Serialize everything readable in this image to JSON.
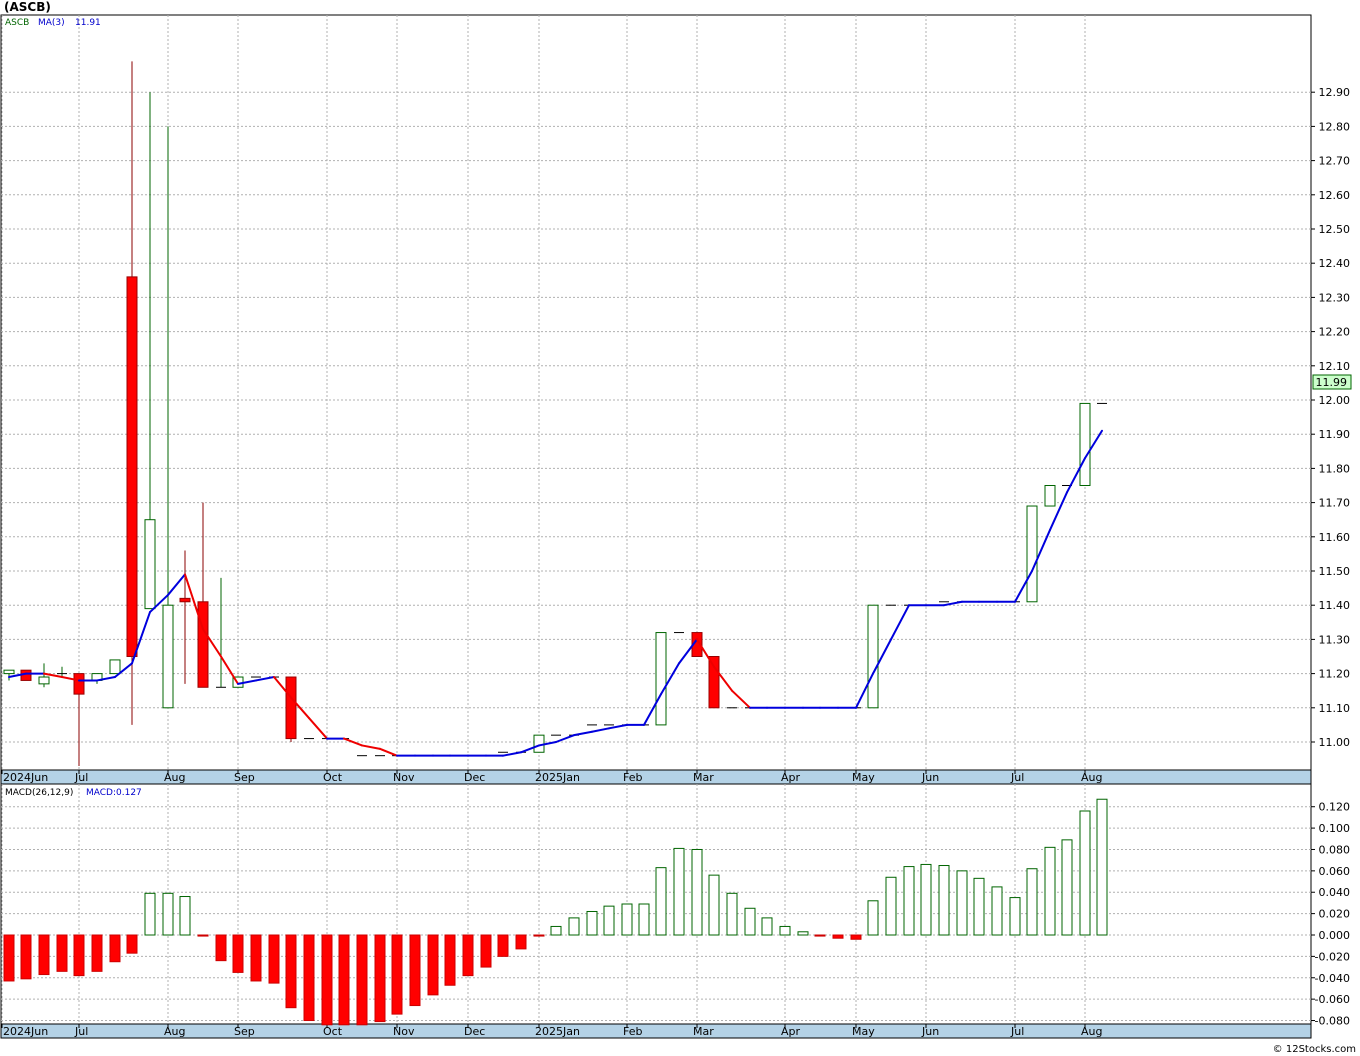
{
  "header": {
    "title": "(ASCB)",
    "credit": "© 12Stocks.com"
  },
  "legend": {
    "symbol": "ASCB",
    "ma_label": "MA(3)",
    "ma_value": "11.91",
    "macd_label": "MACD(26,12,9)",
    "macd_value": "MACD:0.127"
  },
  "last_price": "11.99",
  "colors": {
    "up": "#006400",
    "down": "#ff0000",
    "ma_up": "#0000dd",
    "ma_down": "#ee0000",
    "macd_up": "#006400",
    "macd_down": "#ff0000",
    "axis_band": "#b4d2e6",
    "grid": "#b0b0b0",
    "price_box": "#ccffcc"
  },
  "chart_data": [
    {
      "type": "candlestick",
      "series": [
        {
          "name": "ASCB"
        },
        {
          "name": "MA(3)"
        }
      ],
      "ylim": [
        10.93,
        13.0
      ],
      "y_ticks": [
        "11.00",
        "11.10",
        "11.20",
        "11.30",
        "11.40",
        "11.50",
        "11.60",
        "11.70",
        "11.80",
        "11.90",
        "12.00",
        "12.10",
        "12.20",
        "12.30",
        "12.40",
        "12.50",
        "12.60",
        "12.70",
        "12.80",
        "12.90"
      ],
      "x_ticks": [
        "2024Jun",
        "Jul",
        "Aug",
        "Sep",
        "Oct",
        "Nov",
        "Dec",
        "2025Jan",
        "Feb",
        "Mar",
        "Apr",
        "May",
        "Jun",
        "Jul",
        "Aug"
      ],
      "grid": true,
      "bars": [
        {
          "x": 9,
          "o": 11.2,
          "h": 11.21,
          "l": 11.18,
          "c": 11.21,
          "ma": 11.19
        },
        {
          "x": 26,
          "o": 11.21,
          "h": 11.21,
          "l": 11.18,
          "c": 11.18,
          "ma": 11.2
        },
        {
          "x": 44,
          "o": 11.17,
          "h": 11.23,
          "l": 11.16,
          "c": 11.19,
          "ma": 11.2
        },
        {
          "x": 62,
          "o": 11.2,
          "h": 11.22,
          "l": 11.19,
          "c": 11.2,
          "ma": 11.19
        },
        {
          "x": 79,
          "o": 11.2,
          "h": 11.2,
          "l": 10.93,
          "c": 11.14,
          "ma": 11.18
        },
        {
          "x": 97,
          "o": 11.18,
          "h": 11.2,
          "l": 11.17,
          "c": 11.2,
          "ma": 11.18
        },
        {
          "x": 115,
          "o": 11.2,
          "h": 11.24,
          "l": 11.2,
          "c": 11.24,
          "ma": 11.19
        },
        {
          "x": 132,
          "o": 12.36,
          "h": 12.99,
          "l": 11.05,
          "c": 11.25,
          "ma": 11.23
        },
        {
          "x": 150,
          "o": 11.39,
          "h": 12.9,
          "l": 11.39,
          "c": 11.65,
          "ma": 11.38
        },
        {
          "x": 168,
          "o": 11.1,
          "h": 12.8,
          "l": 11.1,
          "c": 11.4,
          "ma": 11.43
        },
        {
          "x": 185,
          "o": 11.42,
          "h": 11.56,
          "l": 11.17,
          "c": 11.41,
          "ma": 11.49
        },
        {
          "x": 203,
          "o": 11.41,
          "h": 11.7,
          "l": 11.16,
          "c": 11.16,
          "ma": 11.33
        },
        {
          "x": 221,
          "o": 11.16,
          "h": 11.48,
          "l": 11.16,
          "c": 11.16,
          "ma": 11.25
        },
        {
          "x": 238,
          "o": 11.16,
          "h": 11.19,
          "l": 11.16,
          "c": 11.19,
          "ma": 11.17
        },
        {
          "x": 256,
          "o": 11.19,
          "h": 11.19,
          "l": 11.19,
          "c": 11.19,
          "ma": 11.18
        },
        {
          "x": 274,
          "o": 11.19,
          "h": 11.19,
          "l": 11.19,
          "c": 11.19,
          "ma": 11.19
        },
        {
          "x": 291,
          "o": 11.19,
          "h": 11.19,
          "l": 11.0,
          "c": 11.01,
          "ma": 11.13
        },
        {
          "x": 309,
          "o": 11.01,
          "h": 11.01,
          "l": 11.01,
          "c": 11.01,
          "ma": 11.07
        },
        {
          "x": 327,
          "o": 11.01,
          "h": 11.01,
          "l": 11.01,
          "c": 11.01,
          "ma": 11.01
        },
        {
          "x": 344,
          "o": 11.01,
          "h": 11.01,
          "l": 11.01,
          "c": 11.01,
          "ma": 11.01
        },
        {
          "x": 362,
          "o": 10.96,
          "h": 10.96,
          "l": 10.96,
          "c": 10.96,
          "ma": 10.99
        },
        {
          "x": 380,
          "o": 10.96,
          "h": 10.96,
          "l": 10.96,
          "c": 10.96,
          "ma": 10.98
        },
        {
          "x": 397,
          "o": 10.96,
          "h": 10.96,
          "l": 10.96,
          "c": 10.96,
          "ma": 10.96
        },
        {
          "x": 415,
          "o": 10.96,
          "h": 10.96,
          "l": 10.96,
          "c": 10.96,
          "ma": 10.96
        },
        {
          "x": 433,
          "o": 10.96,
          "h": 10.96,
          "l": 10.96,
          "c": 10.96,
          "ma": 10.96
        },
        {
          "x": 450,
          "o": 10.96,
          "h": 10.96,
          "l": 10.96,
          "c": 10.96,
          "ma": 10.96
        },
        {
          "x": 468,
          "o": 10.96,
          "h": 10.96,
          "l": 10.96,
          "c": 10.96,
          "ma": 10.96
        },
        {
          "x": 486,
          "o": 10.96,
          "h": 10.96,
          "l": 10.96,
          "c": 10.96,
          "ma": 10.96
        },
        {
          "x": 503,
          "o": 10.97,
          "h": 10.97,
          "l": 10.97,
          "c": 10.97,
          "ma": 10.96
        },
        {
          "x": 521,
          "o": 10.97,
          "h": 10.97,
          "l": 10.97,
          "c": 10.97,
          "ma": 10.97
        },
        {
          "x": 539,
          "o": 10.97,
          "h": 11.02,
          "l": 10.97,
          "c": 11.02,
          "ma": 10.99
        },
        {
          "x": 556,
          "o": 11.02,
          "h": 11.02,
          "l": 11.02,
          "c": 11.02,
          "ma": 11.0
        },
        {
          "x": 574,
          "o": 11.02,
          "h": 11.02,
          "l": 11.02,
          "c": 11.02,
          "ma": 11.02
        },
        {
          "x": 592,
          "o": 11.05,
          "h": 11.05,
          "l": 11.05,
          "c": 11.05,
          "ma": 11.03
        },
        {
          "x": 609,
          "o": 11.05,
          "h": 11.05,
          "l": 11.05,
          "c": 11.05,
          "ma": 11.04
        },
        {
          "x": 627,
          "o": 11.05,
          "h": 11.05,
          "l": 11.05,
          "c": 11.05,
          "ma": 11.05
        },
        {
          "x": 644,
          "o": 11.05,
          "h": 11.05,
          "l": 11.05,
          "c": 11.05,
          "ma": 11.05
        },
        {
          "x": 661,
          "o": 11.05,
          "h": 11.32,
          "l": 11.05,
          "c": 11.32,
          "ma": 11.14
        },
        {
          "x": 679,
          "o": 11.32,
          "h": 11.32,
          "l": 11.32,
          "c": 11.32,
          "ma": 11.23
        },
        {
          "x": 697,
          "o": 11.32,
          "h": 11.32,
          "l": 11.25,
          "c": 11.25,
          "ma": 11.3
        },
        {
          "x": 714,
          "o": 11.25,
          "h": 11.25,
          "l": 11.1,
          "c": 11.1,
          "ma": 11.22
        },
        {
          "x": 732,
          "o": 11.1,
          "h": 11.1,
          "l": 11.1,
          "c": 11.1,
          "ma": 11.15
        },
        {
          "x": 750,
          "o": 11.1,
          "h": 11.1,
          "l": 11.1,
          "c": 11.1,
          "ma": 11.1
        },
        {
          "x": 767,
          "o": 11.1,
          "h": 11.1,
          "l": 11.1,
          "c": 11.1,
          "ma": 11.1
        },
        {
          "x": 785,
          "o": 11.1,
          "h": 11.1,
          "l": 11.1,
          "c": 11.1,
          "ma": 11.1
        },
        {
          "x": 803,
          "o": 11.1,
          "h": 11.1,
          "l": 11.1,
          "c": 11.1,
          "ma": 11.1
        },
        {
          "x": 820,
          "o": 11.1,
          "h": 11.1,
          "l": 11.1,
          "c": 11.1,
          "ma": 11.1
        },
        {
          "x": 838,
          "o": 11.1,
          "h": 11.1,
          "l": 11.1,
          "c": 11.1,
          "ma": 11.1
        },
        {
          "x": 856,
          "o": 11.1,
          "h": 11.1,
          "l": 11.1,
          "c": 11.1,
          "ma": 11.1
        },
        {
          "x": 873,
          "o": 11.1,
          "h": 11.4,
          "l": 11.1,
          "c": 11.4,
          "ma": 11.2
        },
        {
          "x": 891,
          "o": 11.4,
          "h": 11.4,
          "l": 11.4,
          "c": 11.4,
          "ma": 11.3
        },
        {
          "x": 909,
          "o": 11.4,
          "h": 11.4,
          "l": 11.4,
          "c": 11.4,
          "ma": 11.4
        },
        {
          "x": 926,
          "o": 11.4,
          "h": 11.4,
          "l": 11.4,
          "c": 11.4,
          "ma": 11.4
        },
        {
          "x": 944,
          "o": 11.41,
          "h": 11.41,
          "l": 11.41,
          "c": 11.41,
          "ma": 11.4
        },
        {
          "x": 962,
          "o": 11.41,
          "h": 11.41,
          "l": 11.41,
          "c": 11.41,
          "ma": 11.41
        },
        {
          "x": 979,
          "o": 11.41,
          "h": 11.41,
          "l": 11.41,
          "c": 11.41,
          "ma": 11.41
        },
        {
          "x": 997,
          "o": 11.41,
          "h": 11.41,
          "l": 11.41,
          "c": 11.41,
          "ma": 11.41
        },
        {
          "x": 1015,
          "o": 11.41,
          "h": 11.41,
          "l": 11.41,
          "c": 11.41,
          "ma": 11.41
        },
        {
          "x": 1032,
          "o": 11.41,
          "h": 11.69,
          "l": 11.41,
          "c": 11.69,
          "ma": 11.5
        },
        {
          "x": 1050,
          "o": 11.69,
          "h": 11.75,
          "l": 11.69,
          "c": 11.75,
          "ma": 11.62
        },
        {
          "x": 1067,
          "o": 11.75,
          "h": 11.75,
          "l": 11.75,
          "c": 11.75,
          "ma": 11.73
        },
        {
          "x": 1085,
          "o": 11.75,
          "h": 11.99,
          "l": 11.75,
          "c": 11.99,
          "ma": 11.83
        },
        {
          "x": 1102,
          "o": 11.99,
          "h": 11.99,
          "l": 11.99,
          "c": 11.99,
          "ma": 11.91
        }
      ]
    },
    {
      "type": "bar",
      "series": [
        {
          "name": "MACD(26,12,9)"
        }
      ],
      "ylim": [
        -0.085,
        0.128
      ],
      "y_ticks": [
        "-0.080",
        "-0.060",
        "-0.040",
        "-0.020",
        "0.000",
        "0.020",
        "0.040",
        "0.060",
        "0.080",
        "0.100",
        "0.120"
      ],
      "x_ticks": [
        "2024Jun",
        "Jul",
        "Aug",
        "Sep",
        "Oct",
        "Nov",
        "Dec",
        "2025Jan",
        "Feb",
        "Mar",
        "Apr",
        "May",
        "Jun",
        "Jul",
        "Aug"
      ],
      "grid": true,
      "values": [
        {
          "x": 9,
          "v": -0.043
        },
        {
          "x": 26,
          "v": -0.041
        },
        {
          "x": 44,
          "v": -0.037
        },
        {
          "x": 62,
          "v": -0.034
        },
        {
          "x": 79,
          "v": -0.038
        },
        {
          "x": 97,
          "v": -0.034
        },
        {
          "x": 115,
          "v": -0.025
        },
        {
          "x": 132,
          "v": -0.017
        },
        {
          "x": 150,
          "v": 0.039
        },
        {
          "x": 168,
          "v": 0.039
        },
        {
          "x": 185,
          "v": 0.036
        },
        {
          "x": 203,
          "v": -0.001
        },
        {
          "x": 221,
          "v": -0.024
        },
        {
          "x": 238,
          "v": -0.035
        },
        {
          "x": 256,
          "v": -0.043
        },
        {
          "x": 274,
          "v": -0.045
        },
        {
          "x": 291,
          "v": -0.068
        },
        {
          "x": 309,
          "v": -0.08
        },
        {
          "x": 327,
          "v": -0.084
        },
        {
          "x": 344,
          "v": -0.084
        },
        {
          "x": 362,
          "v": -0.084
        },
        {
          "x": 380,
          "v": -0.081
        },
        {
          "x": 397,
          "v": -0.074
        },
        {
          "x": 415,
          "v": -0.066
        },
        {
          "x": 433,
          "v": -0.056
        },
        {
          "x": 450,
          "v": -0.047
        },
        {
          "x": 468,
          "v": -0.038
        },
        {
          "x": 486,
          "v": -0.03
        },
        {
          "x": 503,
          "v": -0.02
        },
        {
          "x": 521,
          "v": -0.013
        },
        {
          "x": 539,
          "v": -0.001
        },
        {
          "x": 556,
          "v": 0.008
        },
        {
          "x": 574,
          "v": 0.016
        },
        {
          "x": 592,
          "v": 0.022
        },
        {
          "x": 609,
          "v": 0.027
        },
        {
          "x": 627,
          "v": 0.029
        },
        {
          "x": 644,
          "v": 0.029
        },
        {
          "x": 661,
          "v": 0.063
        },
        {
          "x": 679,
          "v": 0.081
        },
        {
          "x": 697,
          "v": 0.08
        },
        {
          "x": 714,
          "v": 0.056
        },
        {
          "x": 732,
          "v": 0.039
        },
        {
          "x": 750,
          "v": 0.025
        },
        {
          "x": 767,
          "v": 0.016
        },
        {
          "x": 785,
          "v": 0.008
        },
        {
          "x": 803,
          "v": 0.003
        },
        {
          "x": 820,
          "v": -0.001
        },
        {
          "x": 838,
          "v": -0.003
        },
        {
          "x": 856,
          "v": -0.004
        },
        {
          "x": 873,
          "v": 0.032
        },
        {
          "x": 891,
          "v": 0.054
        },
        {
          "x": 909,
          "v": 0.064
        },
        {
          "x": 926,
          "v": 0.066
        },
        {
          "x": 944,
          "v": 0.065
        },
        {
          "x": 962,
          "v": 0.06
        },
        {
          "x": 979,
          "v": 0.053
        },
        {
          "x": 997,
          "v": 0.045
        },
        {
          "x": 1015,
          "v": 0.035
        },
        {
          "x": 1032,
          "v": 0.062
        },
        {
          "x": 1050,
          "v": 0.082
        },
        {
          "x": 1067,
          "v": 0.089
        },
        {
          "x": 1085,
          "v": 0.116
        },
        {
          "x": 1102,
          "v": 0.127
        }
      ]
    }
  ]
}
